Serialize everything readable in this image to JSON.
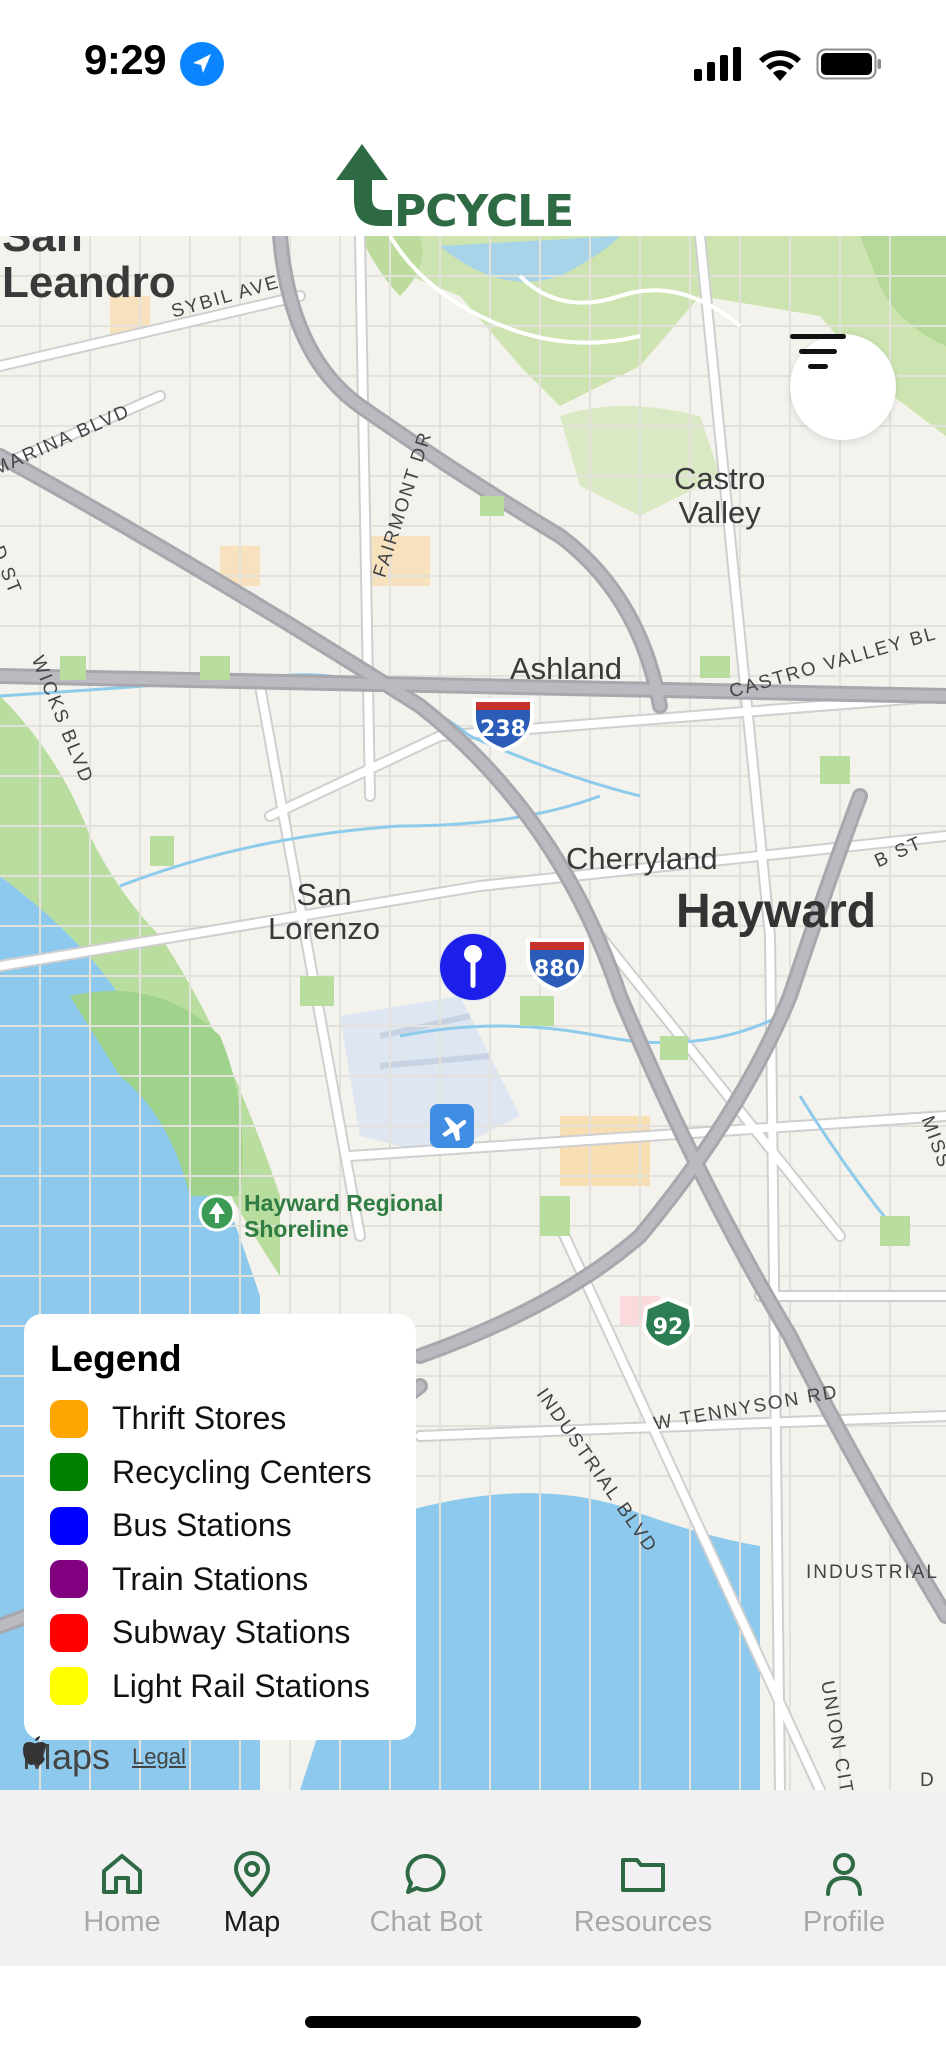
{
  "status_bar": {
    "time": "9:29",
    "location_icon": "location-arrow-icon",
    "signal_icon": "cellular-signal-icon",
    "wifi_icon": "wifi-icon",
    "battery_icon": "battery-icon"
  },
  "header": {
    "logo_text": "UPCYCLE",
    "brand_color": "#2e6b45"
  },
  "map": {
    "filter_icon": "filter-icon",
    "places": {
      "san_leandro": "San\nLeandro",
      "castro_valley_1": "Castro",
      "castro_valley_2": "Valley",
      "ashland": "Ashland",
      "cherryland": "Cherryland",
      "hayward": "Hayward",
      "san_lorenzo_1": "San",
      "san_lorenzo_2": "Lorenzo"
    },
    "streets": {
      "sybil": "SYBIL AVE",
      "marina": "MARINA BLVD",
      "d_st": "D ST",
      "wicks": "WICKS BLVD",
      "fairmont": "FAIRMONT DR",
      "castro_valley_blvd": "CASTRO VALLEY BL",
      "b_st": "B ST",
      "industrial_blvd": "INDUSTRIAL BLVD",
      "tennyson": "W TENNYSON RD",
      "industrial": "INDUSTRIAL",
      "union_city": "UNION CIT",
      "miss": "MISS",
      "d": "D"
    },
    "highways": {
      "i238": "238",
      "i880": "880",
      "sr92": "92"
    },
    "poi": {
      "shoreline_1": "Hayward Regional",
      "shoreline_2": "Shoreline"
    },
    "user_pin_icon": "map-pin-icon",
    "user_location_icon": "current-location-dot-icon",
    "airport_icon": "airport-icon"
  },
  "legend": {
    "title": "Legend",
    "items": [
      {
        "label": "Thrift Stores",
        "color": "#ffa500"
      },
      {
        "label": "Recycling Centers",
        "color": "#008000"
      },
      {
        "label": "Bus Stations",
        "color": "#0000ff"
      },
      {
        "label": "Train Stations",
        "color": "#800080"
      },
      {
        "label": "Subway Stations",
        "color": "#ff0000"
      },
      {
        "label": "Light Rail Stations",
        "color": "#ffff00"
      }
    ]
  },
  "attribution": {
    "maps": "Maps",
    "legal": "Legal"
  },
  "tabs": [
    {
      "label": "Home",
      "icon": "home-icon",
      "active": false
    },
    {
      "label": "Map",
      "icon": "map-pin-icon",
      "active": true
    },
    {
      "label": "Chat Bot",
      "icon": "chat-bubble-icon",
      "active": false
    },
    {
      "label": "Resources",
      "icon": "folder-icon",
      "active": false
    },
    {
      "label": "Profile",
      "icon": "person-icon",
      "active": false
    }
  ]
}
